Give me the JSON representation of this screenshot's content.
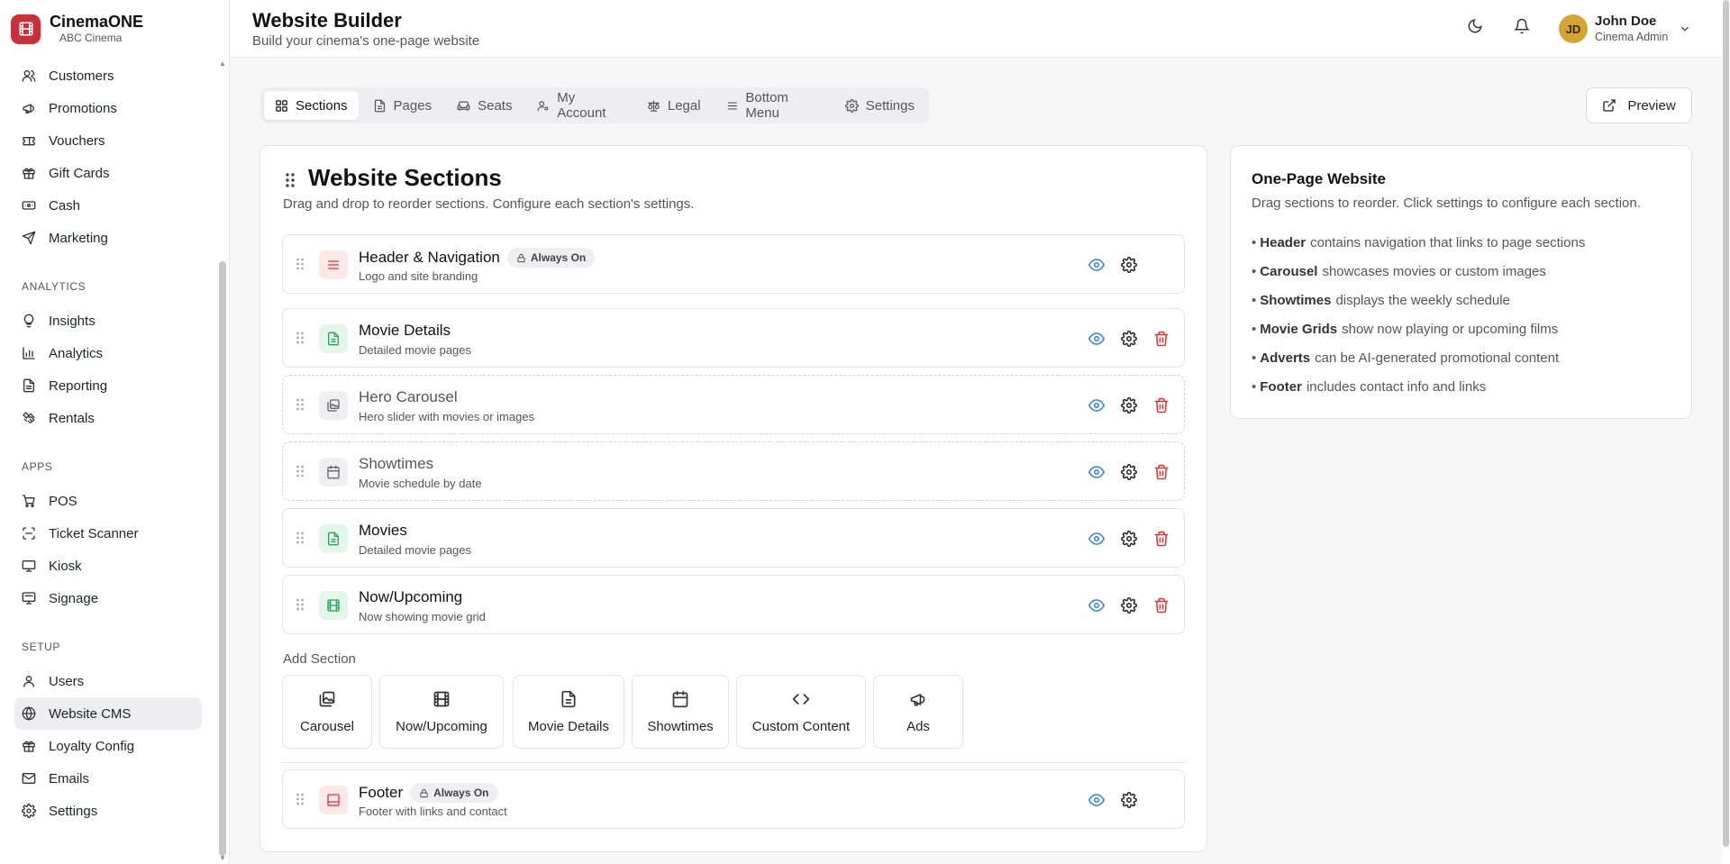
{
  "brand": {
    "name": "CinemaONE",
    "sub": "ABC Cinema",
    "color": "#c8313c"
  },
  "sidebar": {
    "top_items": [
      {
        "label": "Customers",
        "icon": "users-icon"
      },
      {
        "label": "Promotions",
        "icon": "megaphone-icon"
      },
      {
        "label": "Vouchers",
        "icon": "ticket-icon"
      },
      {
        "label": "Gift Cards",
        "icon": "gift-icon"
      },
      {
        "label": "Cash",
        "icon": "banknote-icon"
      },
      {
        "label": "Marketing",
        "icon": "send-icon"
      }
    ],
    "analytics_title": "ANALYTICS",
    "analytics_items": [
      {
        "label": "Insights",
        "icon": "lightbulb-icon"
      },
      {
        "label": "Analytics",
        "icon": "bar-chart-icon"
      },
      {
        "label": "Reporting",
        "icon": "file-text-icon"
      },
      {
        "label": "Rentals",
        "icon": "handshake-icon"
      }
    ],
    "apps_title": "APPS",
    "apps_items": [
      {
        "label": "POS",
        "icon": "cart-icon"
      },
      {
        "label": "Ticket Scanner",
        "icon": "scan-icon"
      },
      {
        "label": "Kiosk",
        "icon": "monitor-icon"
      },
      {
        "label": "Signage",
        "icon": "display-icon"
      }
    ],
    "setup_title": "SETUP",
    "setup_items": [
      {
        "label": "Users",
        "icon": "user-icon"
      },
      {
        "label": "Website CMS",
        "icon": "globe-icon",
        "active": true
      },
      {
        "label": "Loyalty Config",
        "icon": "gift-icon"
      },
      {
        "label": "Emails",
        "icon": "mail-icon"
      },
      {
        "label": "Settings",
        "icon": "gear-icon"
      }
    ]
  },
  "header": {
    "title": "Website Builder",
    "subtitle": "Build your cinema's one-page website",
    "user": {
      "initials": "JD",
      "name": "John Doe",
      "role": "Cinema Admin"
    }
  },
  "tabs": [
    {
      "label": "Sections",
      "icon": "grid-icon",
      "active": true
    },
    {
      "label": "Pages",
      "icon": "file-icon"
    },
    {
      "label": "Seats",
      "icon": "sofa-icon"
    },
    {
      "label": "My Account",
      "icon": "user-cog-icon"
    },
    {
      "label": "Legal",
      "icon": "scale-icon"
    },
    {
      "label": "Bottom Menu",
      "icon": "menu-icon"
    },
    {
      "label": "Settings",
      "icon": "gear-icon"
    }
  ],
  "preview_label": "Preview",
  "main": {
    "title": "Website Sections",
    "subtitle": "Drag and drop to reorder sections. Configure each section's settings.",
    "sections": [
      {
        "name": "Header & Navigation",
        "desc": "Logo and site branding",
        "badge": "Always On",
        "icon": "menu-icon",
        "tone": "red",
        "dashed": false,
        "deletable": false
      },
      {
        "name": "Movie Details",
        "desc": "Detailed movie pages",
        "icon": "file-icon",
        "tone": "green",
        "dashed": false,
        "deletable": true
      },
      {
        "name": "Hero Carousel",
        "desc": "Hero slider with movies or images",
        "icon": "images-icon",
        "tone": "gray",
        "dashed": true,
        "deletable": true
      },
      {
        "name": "Showtimes",
        "desc": "Movie schedule by date",
        "icon": "calendar-icon",
        "tone": "gray",
        "dashed": true,
        "deletable": true
      },
      {
        "name": "Movies",
        "desc": "Detailed movie pages",
        "icon": "file-icon",
        "tone": "green",
        "dashed": false,
        "deletable": true
      },
      {
        "name": "Now/Upcoming",
        "desc": "Now showing movie grid",
        "icon": "film-icon",
        "tone": "green",
        "dashed": false,
        "deletable": true
      }
    ],
    "add_section_label": "Add Section",
    "add_buttons": [
      {
        "label": "Carousel",
        "icon": "images-icon"
      },
      {
        "label": "Now/Upcoming",
        "icon": "film-icon"
      },
      {
        "label": "Movie Details",
        "icon": "file-icon"
      },
      {
        "label": "Showtimes",
        "icon": "calendar-icon"
      },
      {
        "label": "Custom Content",
        "icon": "code-icon"
      },
      {
        "label": "Ads",
        "icon": "megaphone-icon"
      }
    ],
    "footer": {
      "name": "Footer",
      "desc": "Footer with links and contact",
      "badge": "Always On",
      "icon": "panel-bottom-icon",
      "tone": "red"
    }
  },
  "info": {
    "title": "One-Page Website",
    "subtitle": "Drag sections to reorder. Click settings to configure each section.",
    "items": [
      {
        "bold": "Header",
        "text": "contains navigation that links to page sections"
      },
      {
        "bold": "Carousel",
        "text": "showcases movies or custom images"
      },
      {
        "bold": "Showtimes",
        "text": "displays the weekly schedule"
      },
      {
        "bold": "Movie Grids",
        "text": "show now playing or upcoming films"
      },
      {
        "bold": "Adverts",
        "text": "can be AI-generated promotional content"
      },
      {
        "bold": "Footer",
        "text": "includes contact info and links"
      }
    ]
  },
  "colors": {
    "eye": "#2f7fd6",
    "trash": "#d33333",
    "active_nav": "#eeeef0",
    "avatar": "#d4a535"
  }
}
